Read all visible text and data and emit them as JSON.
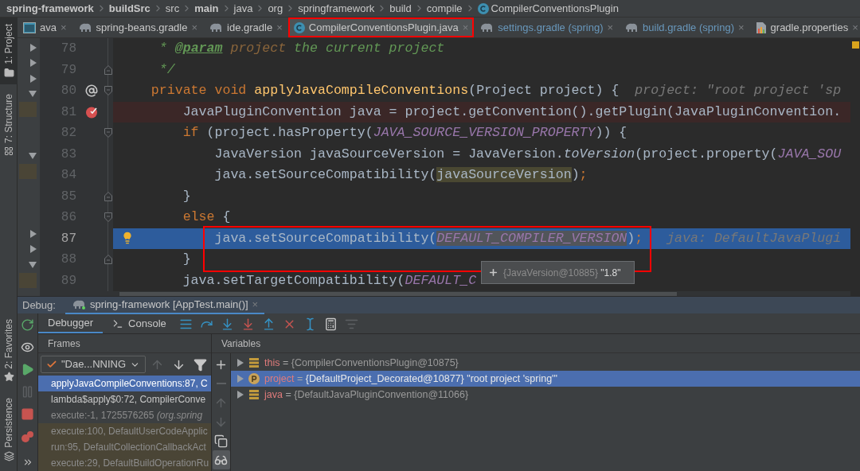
{
  "breadcrumb": [
    {
      "label": "spring-framework",
      "bold": true,
      "kind": "folder"
    },
    {
      "label": "buildSrc",
      "bold": true,
      "kind": "folder"
    },
    {
      "label": "src",
      "bold": false,
      "kind": "folder"
    },
    {
      "label": "main",
      "bold": true,
      "kind": "folder"
    },
    {
      "label": "java",
      "bold": false,
      "kind": "folder"
    },
    {
      "label": "org",
      "bold": false,
      "kind": "folder"
    },
    {
      "label": "springframework",
      "bold": false,
      "kind": "folder"
    },
    {
      "label": "build",
      "bold": false,
      "kind": "folder"
    },
    {
      "label": "compile",
      "bold": false,
      "kind": "folder"
    },
    {
      "label": "CompilerConventionsPlugin",
      "bold": false,
      "kind": "class"
    }
  ],
  "tool_strip": {
    "top": [
      {
        "label": "1: Project",
        "kind": "folder",
        "selected": true
      },
      {
        "label": "7: Structure",
        "kind": "structure",
        "selected": false
      }
    ],
    "bottom": [
      {
        "label": "2: Favorites",
        "kind": "star",
        "selected": false
      },
      {
        "label": "Persistence",
        "kind": "persistence",
        "selected": false
      }
    ]
  },
  "tabs": [
    {
      "label": "ava",
      "kind": "java",
      "selected": false,
      "modified": false,
      "framed": false,
      "close": "×"
    },
    {
      "label": "spring-beans.gradle",
      "kind": "gradle",
      "selected": false,
      "modified": false,
      "framed": false,
      "close": "×"
    },
    {
      "label": "ide.gradle",
      "kind": "gradle",
      "selected": false,
      "modified": false,
      "framed": false,
      "close": "×"
    },
    {
      "label": "CompilerConventionsPlugin.java",
      "kind": "class",
      "selected": true,
      "modified": false,
      "framed": true,
      "close": "×"
    },
    {
      "label": "settings.gradle (spring)",
      "kind": "gradle",
      "selected": false,
      "modified": true,
      "framed": false,
      "close": "×"
    },
    {
      "label": "build.gradle (spring)",
      "kind": "gradle",
      "selected": false,
      "modified": true,
      "framed": false,
      "close": "×"
    },
    {
      "label": "gradle.properties",
      "kind": "properties",
      "selected": false,
      "modified": false,
      "framed": false,
      "close": "×"
    }
  ],
  "tree_rows": [
    {
      "kind": "node",
      "expanded": false
    },
    {
      "kind": "node",
      "expanded": false
    },
    {
      "kind": "node",
      "expanded": false
    },
    {
      "kind": "node",
      "expanded": true
    },
    {
      "kind": "changed"
    },
    {
      "kind": "blank"
    },
    {
      "kind": "blank"
    },
    {
      "kind": "node",
      "expanded": true
    },
    {
      "kind": "changed"
    },
    {
      "kind": "blank"
    },
    {
      "kind": "blank"
    },
    {
      "kind": "blank"
    },
    {
      "kind": "node",
      "expanded": false
    },
    {
      "kind": "node",
      "expanded": false
    },
    {
      "kind": "node",
      "expanded": true
    },
    {
      "kind": "changed"
    }
  ],
  "lines": [
    {
      "number": "78",
      "breakpoint": false,
      "execution": false,
      "annotated": false,
      "intention": false,
      "fold_start": false,
      "fold_end": false,
      "framed": false,
      "tokens": [
        {
          "text": "     * ",
          "kind": "doc"
        },
        {
          "text": "@param",
          "kind": "doctag"
        },
        {
          "text": " project",
          "kind": "docparam"
        },
        {
          "text": " the current project",
          "kind": "doc"
        }
      ]
    },
    {
      "number": "79",
      "breakpoint": false,
      "execution": false,
      "annotated": false,
      "intention": false,
      "fold_start": false,
      "fold_end": true,
      "framed": false,
      "tokens": [
        {
          "text": "     */",
          "kind": "doc"
        }
      ]
    },
    {
      "number": "80",
      "breakpoint": false,
      "execution": false,
      "annotated": true,
      "intention": false,
      "fold_start": true,
      "fold_end": false,
      "framed": false,
      "tokens": [
        {
          "text": "    private void ",
          "kind": "keyword"
        },
        {
          "text": "applyJavaCompileConventions",
          "kind": "decl"
        },
        {
          "text": "(Project project) {  ",
          "kind": "plain"
        },
        {
          "text": "project: \"root project 'sp",
          "kind": "hint"
        }
      ]
    },
    {
      "number": "81",
      "breakpoint": true,
      "execution": false,
      "annotated": false,
      "intention": false,
      "fold_start": false,
      "fold_end": false,
      "framed": false,
      "tokens": [
        {
          "text": "        JavaPluginConvention java = project.getConvention().getPlugin(JavaPluginConvention.",
          "kind": "plain"
        }
      ]
    },
    {
      "number": "82",
      "breakpoint": false,
      "execution": false,
      "annotated": false,
      "intention": false,
      "fold_start": true,
      "fold_end": false,
      "framed": false,
      "tokens": [
        {
          "text": "        if ",
          "kind": "keyword"
        },
        {
          "text": "(project.hasProperty(",
          "kind": "plain"
        },
        {
          "text": "JAVA_SOURCE_VERSION_PROPERTY",
          "kind": "const"
        },
        {
          "text": ")) {",
          "kind": "plain"
        }
      ]
    },
    {
      "number": "83",
      "breakpoint": false,
      "execution": false,
      "annotated": false,
      "intention": false,
      "fold_start": false,
      "fold_end": false,
      "framed": false,
      "tokens": [
        {
          "text": "            JavaVersion javaSourceVersion = JavaVersion.",
          "kind": "plain"
        },
        {
          "text": "toVersion",
          "kind": "static"
        },
        {
          "text": "(project.property(",
          "kind": "plain"
        },
        {
          "text": "JAVA_SOU",
          "kind": "const"
        }
      ]
    },
    {
      "number": "84",
      "breakpoint": false,
      "execution": false,
      "annotated": false,
      "intention": false,
      "fold_start": false,
      "fold_end": false,
      "framed": false,
      "tokens": [
        {
          "text": "            java.setSourceCompatibility(",
          "kind": "plain"
        },
        {
          "text": "javaSourceVersion",
          "kind": "usage"
        },
        {
          "text": ")",
          "kind": "plain"
        },
        {
          "text": ";",
          "kind": "semi"
        }
      ]
    },
    {
      "number": "85",
      "breakpoint": false,
      "execution": false,
      "annotated": false,
      "intention": false,
      "fold_start": false,
      "fold_end": true,
      "framed": false,
      "tokens": [
        {
          "text": "        }",
          "kind": "plain"
        }
      ]
    },
    {
      "number": "86",
      "breakpoint": false,
      "execution": false,
      "annotated": false,
      "intention": false,
      "fold_start": true,
      "fold_end": false,
      "framed": false,
      "tokens": [
        {
          "text": "        else ",
          "kind": "keyword"
        },
        {
          "text": "{",
          "kind": "plain"
        }
      ]
    },
    {
      "number": "87",
      "breakpoint": false,
      "execution": true,
      "annotated": false,
      "intention": true,
      "fold_start": false,
      "fold_end": false,
      "framed": true,
      "tokens": [
        {
          "text": "            java.setSourceCompatibility(",
          "kind": "plain"
        },
        {
          "text": "DEFAULT_COMPILER_VERSION",
          "kind": "const_selected"
        },
        {
          "text": ")",
          "kind": "plain"
        },
        {
          "text": ";",
          "kind": "semi"
        },
        {
          "text": "   java: DefaultJavaPlugi",
          "kind": "hint"
        }
      ]
    },
    {
      "number": "88",
      "breakpoint": false,
      "execution": false,
      "annotated": false,
      "intention": false,
      "fold_start": false,
      "fold_end": true,
      "framed": false,
      "tokens": [
        {
          "text": "        }",
          "kind": "plain"
        }
      ]
    },
    {
      "number": "89",
      "breakpoint": false,
      "execution": false,
      "annotated": false,
      "intention": false,
      "fold_start": false,
      "fold_end": false,
      "framed": false,
      "tokens": [
        {
          "text": "        java.setTargetCompatibility(",
          "kind": "plain"
        },
        {
          "text": "DEFAULT_C",
          "kind": "const"
        }
      ]
    }
  ],
  "tooltip": {
    "type": "{JavaVersion@10885}",
    "value": "\"1.8\""
  },
  "debug": {
    "title": "Debug:",
    "session": {
      "label": "spring-framework [AppTest.main()]",
      "close": "×"
    },
    "side_actions": [
      {
        "kind": "rerun",
        "disabled": false
      },
      {
        "kind": "watch",
        "disabled": false
      },
      {
        "kind": "resume",
        "disabled": false
      },
      {
        "kind": "pause",
        "disabled": true
      },
      {
        "kind": "stop",
        "disabled": false
      },
      {
        "kind": "breakpoints",
        "disabled": false
      },
      {
        "kind": "more",
        "disabled": false
      }
    ],
    "tabs": [
      {
        "label": "Debugger",
        "kind": "debugger",
        "selected": true
      },
      {
        "label": "Console",
        "kind": "console",
        "selected": false
      }
    ],
    "toolbar": [
      {
        "kind": "menu",
        "disabled": false
      },
      {
        "kind": "step_over",
        "disabled": false
      },
      {
        "kind": "step_into",
        "disabled": false
      },
      {
        "kind": "force_step_into",
        "disabled": false
      },
      {
        "kind": "step_out",
        "disabled": false
      },
      {
        "kind": "drop_frame",
        "disabled": false
      },
      {
        "kind": "run_to_cursor",
        "disabled": false
      },
      {
        "kind": "evaluate",
        "disabled": false
      },
      {
        "kind": "trace",
        "disabled": true
      }
    ],
    "frames_title": "Frames",
    "thread": "\"Dae...NNING",
    "frame_nav": [
      {
        "kind": "up",
        "disabled": true
      },
      {
        "kind": "down",
        "disabled": false
      },
      {
        "kind": "filter",
        "disabled": false
      }
    ],
    "frames": [
      {
        "text": "applyJavaCompileConventions:87, C",
        "kind": "project",
        "selected": true
      },
      {
        "text": "lambda$apply$0:72, CompilerConve",
        "kind": "project",
        "selected": false
      },
      {
        "text": "execute:-1, 1725576265 *(org.spring*",
        "kind": "library",
        "selected": false
      },
      {
        "text": "execute:100, DefaultUserCodeApplic",
        "kind": "async",
        "selected": false
      },
      {
        "text": "run:95, DefaultCollectionCallbackAct",
        "kind": "async",
        "selected": false
      },
      {
        "text": "execute:29, DefaultBuildOperationRu",
        "kind": "async",
        "selected": false
      }
    ],
    "variables_title": "Variables",
    "variable_actions": [
      {
        "kind": "add",
        "disabled": false
      },
      {
        "kind": "remove",
        "disabled": true
      },
      {
        "kind": "up",
        "disabled": true
      },
      {
        "kind": "down",
        "disabled": true
      },
      {
        "kind": "copy",
        "disabled": false
      },
      {
        "kind": "glasses",
        "disabled": false
      }
    ],
    "variables": [
      {
        "name": "this",
        "separator": "=",
        "value": "{CompilerConventionsPlugin@10875}",
        "kind": "field",
        "selected": false,
        "expanded": false
      },
      {
        "name": "project",
        "separator": "=",
        "value": "{DefaultProject_Decorated@10877} \"root project 'spring'\"",
        "kind": "parameter",
        "selected": true,
        "expanded": false
      },
      {
        "name": "java",
        "separator": "=",
        "value": "{DefaultJavaPluginConvention@11066}",
        "kind": "field",
        "selected": false,
        "expanded": false
      }
    ]
  }
}
